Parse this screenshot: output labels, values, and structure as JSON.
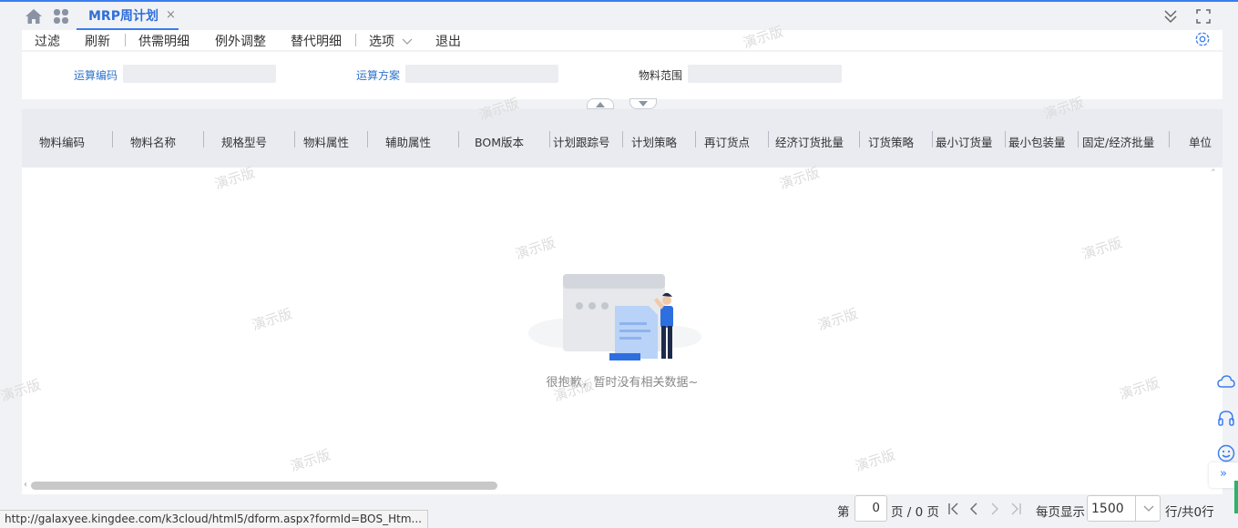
{
  "tabs": {
    "active_label": "MRP周计划",
    "close_glyph": "×"
  },
  "toolbar": {
    "items": [
      "过滤",
      "刷新",
      "供需明细",
      "例外调整",
      "替代明细",
      "选项",
      "退出"
    ]
  },
  "filter": {
    "calc_code_label": "运算编码",
    "calc_plan_label": "运算方案",
    "material_range_label": "物料范围",
    "calc_code_value": "",
    "calc_plan_value": "",
    "material_range_value": ""
  },
  "grid": {
    "columns": [
      "物料编码",
      "物料名称",
      "规格型号",
      "物料属性",
      "辅助属性",
      "BOM版本",
      "计划跟踪号",
      "计划策略",
      "再订货点",
      "经济订货批量",
      "订货策略",
      "最小订货量",
      "最小包装量",
      "固定/经济批量",
      "单位"
    ],
    "empty_message": "很抱歉，暂时没有相关数据~"
  },
  "pager": {
    "page_prefix": "第",
    "page_value": "0",
    "page_suffix": "页 / 0 页",
    "per_page_label": "每页显示",
    "per_page_value": "1500",
    "rows_total": "行/共0行"
  },
  "status_bar": {
    "url": "http://galaxyee.kingdee.com/k3cloud/html5/dform.aspx?formId=BOS_Htm..."
  },
  "watermark": "演示版",
  "colors": {
    "accent": "#3a7df0",
    "link_label": "#2f74cf",
    "header_bg": "#e9ebf0"
  }
}
